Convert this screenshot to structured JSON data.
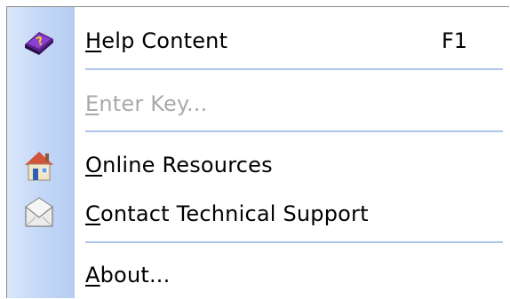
{
  "menu": {
    "items": [
      {
        "name": "help-content",
        "prefix": "",
        "mnemonic": "H",
        "rest": "elp Content",
        "shortcut": "F1",
        "icon": "help-book-icon",
        "enabled": true
      },
      {
        "name": "enter-key",
        "prefix": "",
        "mnemonic": "E",
        "rest": "nter Key...",
        "shortcut": "",
        "icon": "",
        "enabled": false
      },
      {
        "name": "online-resources",
        "prefix": "",
        "mnemonic": "O",
        "rest": "nline Resources",
        "shortcut": "",
        "icon": "house-icon",
        "enabled": true
      },
      {
        "name": "contact-technical-support",
        "prefix": "",
        "mnemonic": "C",
        "rest": "ontact Technical Support",
        "shortcut": "",
        "icon": "envelope-icon",
        "enabled": true
      },
      {
        "name": "about",
        "prefix": "",
        "mnemonic": "A",
        "rest": "bout...",
        "shortcut": "",
        "icon": "",
        "enabled": true
      }
    ]
  },
  "colors": {
    "gutter": "#c2d6f6",
    "separator": "#aec4ea",
    "disabled_text": "#a9a9a9"
  }
}
